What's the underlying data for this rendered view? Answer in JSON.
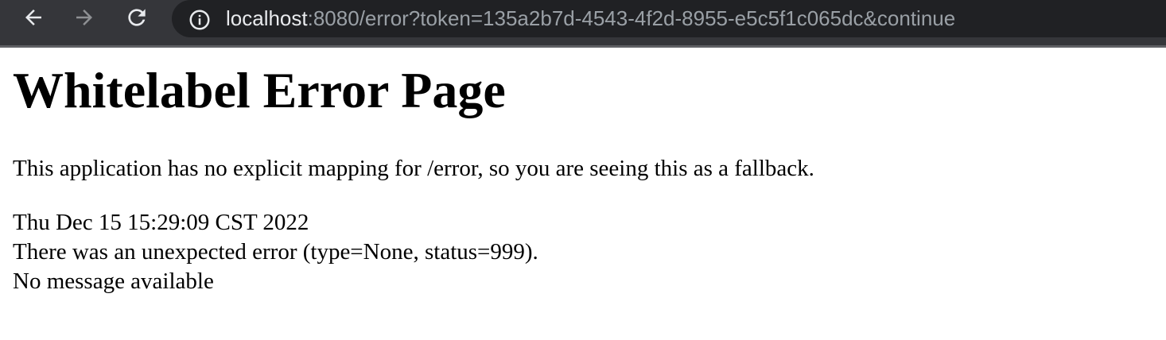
{
  "browser": {
    "url_host": "localhost",
    "url_rest": ":8080/error?token=135a2b7d-4543-4f2d-8955-e5c5f1c065dc&continue",
    "icons": {
      "back": "back-arrow-icon",
      "forward": "forward-arrow-icon",
      "reload": "reload-icon",
      "site_info": "info-icon"
    }
  },
  "page": {
    "title": "Whitelabel Error Page",
    "description": "This application has no explicit mapping for /error, so you are seeing this as a fallback.",
    "timestamp": "Thu Dec 15 15:29:09 CST 2022",
    "error_line": "There was an unexpected error (type=None, status=999).",
    "message": "No message available"
  },
  "colors": {
    "toolbar_bg": "#35363a",
    "omnibox_bg": "#202124",
    "url_host_text": "#e8eaed",
    "url_path_text": "#9aa0a6"
  }
}
